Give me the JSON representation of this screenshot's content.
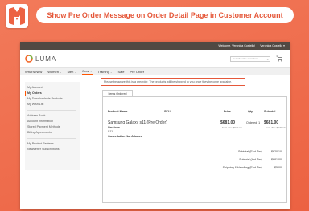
{
  "banner": {
    "title": "Show Pre Order Message on Order Detail Page in Customer Account"
  },
  "colors": {
    "banner": "#ef6f4f",
    "accent": "#e5583a",
    "topbar": "#514943",
    "nav_active": "#ff5501"
  },
  "topbar": {
    "welcome": "Welcome, Veronica Costello!",
    "account": "Veronica Costello ▾"
  },
  "header": {
    "logo_text": "LUMA",
    "search_placeholder": "Search entire store here..."
  },
  "nav": {
    "items": [
      {
        "label": "What's New"
      },
      {
        "label": "Women"
      },
      {
        "label": "Men"
      },
      {
        "label": "Gear"
      },
      {
        "label": "Training"
      },
      {
        "label": "Sale"
      },
      {
        "label": "Pre Order"
      }
    ]
  },
  "sidebar": {
    "items": [
      {
        "label": "My Account"
      },
      {
        "label": "My Orders"
      },
      {
        "label": "My Downloadable Products"
      },
      {
        "label": "My Wish List"
      },
      {
        "label": "Address Book"
      },
      {
        "label": "Account Information"
      },
      {
        "label": "Stored Payment Methods"
      },
      {
        "label": "Billing Agreements"
      },
      {
        "label": "My Product Reviews"
      },
      {
        "label": "Newsletter Subscriptions"
      }
    ]
  },
  "order": {
    "notice": "Please be aware this is a preorder. The products will be shipped to you once they become available.",
    "tab": "Items Ordered",
    "columns": {
      "product": "Product Name",
      "sku": "SKU",
      "price": "Price",
      "qty": "Qty",
      "subtotal": "Subtotal"
    },
    "item": {
      "name": "Samsung Galaxy s11 (Pre Order)",
      "versions_label": "Versions",
      "versions_value": "S11",
      "cancellation": "Cancellation Not Allowed",
      "price": "$681.00",
      "price_excl": "Excl. Tax: $620.10",
      "qty": "Ordered: 1",
      "subtotal": "$681.00",
      "subtotal_excl": "Excl. Tax: $620.10"
    },
    "totals": [
      {
        "label": "Subtotal (Excl.Tax)",
        "value": "$620.10"
      },
      {
        "label": "Subtotal (Incl.Tax)",
        "value": "$681.00"
      },
      {
        "label": "Shipping & Handling (Excl.Tax)",
        "value": "$5.00"
      }
    ]
  }
}
